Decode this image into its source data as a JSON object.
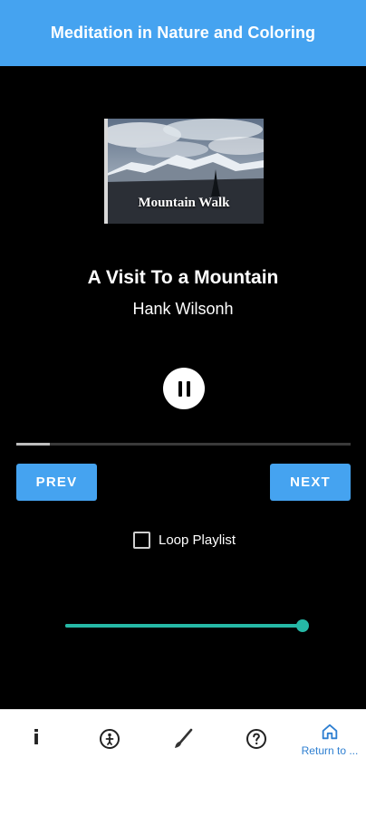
{
  "app_bar": {
    "title": "Meditation in Nature and Coloring"
  },
  "player": {
    "album_art": {
      "caption": "Mountain Walk"
    },
    "track_title": "A Visit To a Mountain",
    "artist": "Hank Wilsonh",
    "state": "playing",
    "progress_fraction": 0.1,
    "prev_label": "PREV",
    "next_label": "NEXT",
    "loop": {
      "label": "Loop Playlist",
      "checked": false
    },
    "volume_fraction": 1.0
  },
  "bottom_nav": {
    "items": [
      {
        "icon": "info-icon",
        "label": ""
      },
      {
        "icon": "meditation-icon",
        "label": ""
      },
      {
        "icon": "brush-icon",
        "label": ""
      },
      {
        "icon": "help-icon",
        "label": ""
      },
      {
        "icon": "home-icon",
        "label": "Return to ...",
        "active": true
      }
    ]
  },
  "colors": {
    "accent": "#45a3f0",
    "slider": "#26b8a6",
    "background": "#000000",
    "nav_active": "#2e7fd1"
  }
}
